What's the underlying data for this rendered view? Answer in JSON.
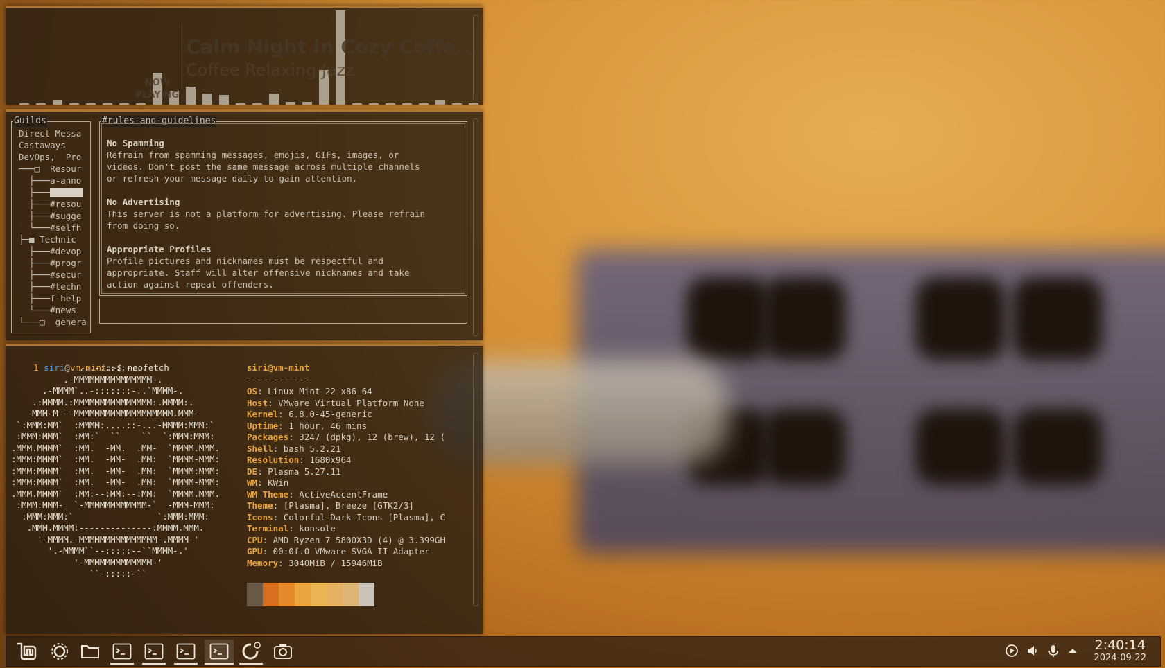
{
  "music": {
    "now_playing_label": "NOW PLAYING",
    "title": "Calm Night in Cozy Coffe...",
    "artist": "Coffee Relaxing Jazz"
  },
  "discord": {
    "guilds_label": "Guilds",
    "tree": [
      "Direct Messa",
      "Castaways",
      "DevOps,  Pro",
      "───□  Resour",
      "  ├───a-anno",
      "  ├───",
      "  ├───#resou",
      "  ├───#sugge",
      "  └───#selfh",
      "├─■ Technic",
      "  ├───#devop",
      "  ├───#progr",
      "  ├───#secur",
      "  ├───#techn",
      "  ├───f-help",
      "  └───#news",
      "└───□  genera"
    ],
    "channel_label": "#rules-and-guidelines",
    "rules": [
      {
        "heading": "No Spamming",
        "body": "Refrain from spamming messages, emojis, GIFs, images, or\nvideos. Don't post the same message across multiple channels\nor refresh your message daily to gain attention."
      },
      {
        "heading": "No Advertising",
        "body": "This server is not a platform for advertising. Please refrain\nfrom doing so."
      },
      {
        "heading": "Appropriate Profiles",
        "body": "Profile pictures and nicknames must be respectful and\nappropriate. Staff will alter offensive nicknames and take\naction against repeat offenders."
      }
    ],
    "message_input_value": ""
  },
  "terminal": {
    "prompt_num": "1",
    "user": "siri",
    "at": "@",
    "host": "vm-mint",
    "path": ":~$",
    "command": " neofetch",
    "header": "siri@vm-mint",
    "separator": "------------",
    "art": [
      "             ...-:::::-...",
      "          .-MMMMMMMMMMMMMMM-.",
      "      .-MMMM`..-:::::::-..`MMMM-.",
      "    .:MMMM.:MMMMMMMMMMMMMMM:.MMMM:.",
      "   -MMM-M---MMMMMMMMMMMMMMMMMMM.MMM-",
      " `:MMM:MM`  :MMMM:....::-...-MMMM:MMM:`",
      " :MMM:MMM`  :MM:`  ``    ``  `:MMM:MMM:",
      ".MMM.MMMM`  :MM.  -MM.  .MM-  `MMMM.MMM.",
      ":MMM:MMMM`  :MM.  -MM-  .MM:  `MMMM-MMM:",
      ":MMM:MMMM`  :MM.  -MM-  .MM:  `MMMM:MMM:",
      ":MMM:MMMM`  :MM.  -MM-  .MM:  `MMMM-MMM:",
      ".MMM.MMMM`  :MM:--:MM:--:MM:  `MMMM.MMM.",
      " :MMM:MMM-  `-MMMMMMMMMMMM-`  -MMM-MMM:",
      "  :MMM:MMM:`                `:MMM:MMM:",
      "   .MMM.MMMM:--------------:MMMM.MMM.",
      "     '-MMMM.-MMMMMMMMMMMMMMM-.MMMM-'",
      "       '.-MMMM``--:::::--``MMMM-.'",
      "            '-MMMMMMMMMMMMM-'",
      "               ``-:::::-``"
    ],
    "info": [
      {
        "key": "OS",
        "value": "Linux Mint 22 x86_64"
      },
      {
        "key": "Host",
        "value": "VMware Virtual Platform None"
      },
      {
        "key": "Kernel",
        "value": "6.8.0-45-generic"
      },
      {
        "key": "Uptime",
        "value": "1 hour, 46 mins"
      },
      {
        "key": "Packages",
        "value": "3247 (dpkg), 12 (brew), 12 ("
      },
      {
        "key": "Shell",
        "value": "bash 5.2.21"
      },
      {
        "key": "Resolution",
        "value": "1680x964"
      },
      {
        "key": "DE",
        "value": "Plasma 5.27.11"
      },
      {
        "key": "WM",
        "value": "KWin"
      },
      {
        "key": "WM Theme",
        "value": "ActiveAccentFrame"
      },
      {
        "key": "Theme",
        "value": "[Plasma], Breeze [GTK2/3]"
      },
      {
        "key": "Icons",
        "value": "Colorful-Dark-Icons [Plasma], C"
      },
      {
        "key": "Terminal",
        "value": "konsole"
      },
      {
        "key": "CPU",
        "value": "AMD Ryzen 7 5800X3D (4) @ 3.399GH"
      },
      {
        "key": "GPU",
        "value": "00:0f.0 VMware SVGA II Adapter"
      },
      {
        "key": "Memory",
        "value": "3040MiB / 15946MiB"
      }
    ],
    "palette": [
      "#6a5848",
      "#d86f1e",
      "#e48a2a",
      "#e9a43f",
      "#eab455",
      "#e5b263",
      "#ddb577",
      "#c9c3ba"
    ]
  },
  "taskbar": {
    "icons": [
      "mint-menu-icon",
      "settings-icon",
      "file-manager-icon",
      "terminal-icon",
      "terminal-icon",
      "terminal-icon",
      "terminal-icon",
      "update-manager-icon",
      "screenshot-icon"
    ],
    "time": "2:40:14",
    "date": "2024-09-22"
  }
}
